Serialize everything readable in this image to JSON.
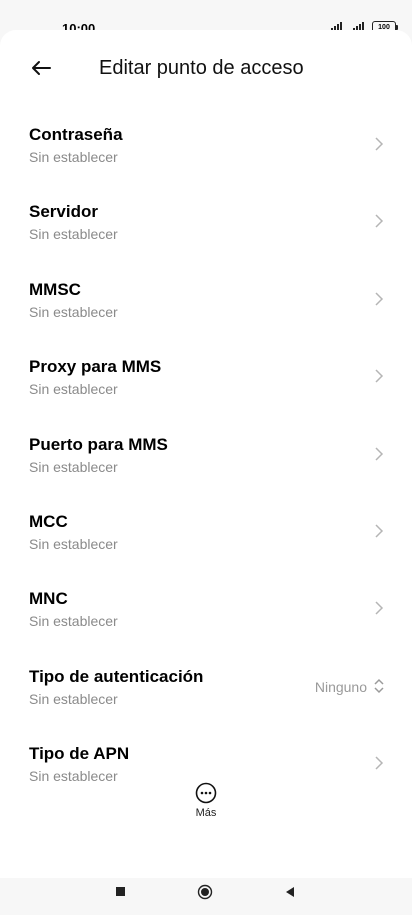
{
  "status": {
    "time": "10:00",
    "battery": "100"
  },
  "header": {
    "title": "Editar punto de acceso"
  },
  "items": [
    {
      "label": "Contraseña",
      "sub": "Sin establecer"
    },
    {
      "label": "Servidor",
      "sub": "Sin establecer"
    },
    {
      "label": "MMSC",
      "sub": "Sin establecer"
    },
    {
      "label": "Proxy para MMS",
      "sub": "Sin establecer"
    },
    {
      "label": "Puerto para MMS",
      "sub": "Sin establecer"
    },
    {
      "label": "MCC",
      "sub": "Sin establecer"
    },
    {
      "label": "MNC",
      "sub": "Sin establecer"
    },
    {
      "label": "Tipo de autenticación",
      "sub": "Sin establecer",
      "value": "Ninguno"
    },
    {
      "label": "Tipo de APN",
      "sub": "Sin establecer"
    }
  ],
  "more": {
    "label": "Más"
  },
  "icons": {
    "back": "arrow-left-icon",
    "chevron": "chevron-right-icon",
    "updown": "chevron-up-down-icon",
    "more": "more-horizontal-icon"
  }
}
